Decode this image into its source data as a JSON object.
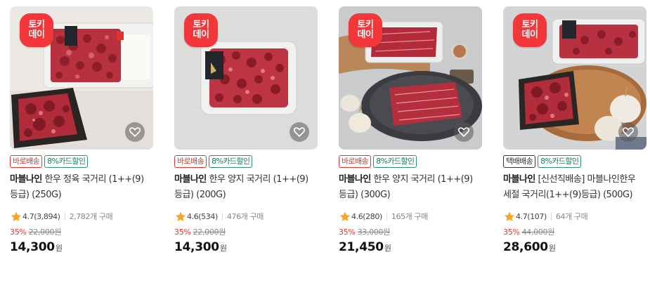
{
  "products": [
    {
      "promo_line1": "토키",
      "promo_line2": "데이",
      "badges": [
        {
          "label": "바로배송",
          "style": "red"
        },
        {
          "label": "8%카드할인",
          "style": "green"
        }
      ],
      "brand": "마블나인",
      "name": "한우 정육 국거리 (1++(9)등급) (250G)",
      "rating": "4.7(3,894)",
      "sold": "2,782개 구매",
      "discount": "35%",
      "original_price": "22,000원",
      "price": "14,300",
      "currency": "원",
      "wishlist_icon": "heart-icon"
    },
    {
      "promo_line1": "토키",
      "promo_line2": "데이",
      "badges": [
        {
          "label": "바로배송",
          "style": "red"
        },
        {
          "label": "8%카드할인",
          "style": "green"
        }
      ],
      "brand": "마블나인",
      "name": "한우 양지 국거리 (1++(9)등급) (200G)",
      "rating": "4.6(534)",
      "sold": "476개 구매",
      "discount": "35%",
      "original_price": "22,000원",
      "price": "14,300",
      "currency": "원",
      "wishlist_icon": "heart-icon"
    },
    {
      "promo_line1": "토키",
      "promo_line2": "데이",
      "badges": [
        {
          "label": "바로배송",
          "style": "red"
        },
        {
          "label": "8%카드할인",
          "style": "green"
        }
      ],
      "brand": "마블나인",
      "name": "한우 양지 국거리 (1++(9)등급) (300G)",
      "rating": "4.6(280)",
      "sold": "165개 구매",
      "discount": "35%",
      "original_price": "33,000원",
      "price": "21,450",
      "currency": "원",
      "wishlist_icon": "heart-icon"
    },
    {
      "promo_line1": "토키",
      "promo_line2": "데이",
      "badges": [
        {
          "label": "택배배송",
          "style": "dark"
        },
        {
          "label": "8%카드할인",
          "style": "green"
        }
      ],
      "brand": "마블나인",
      "name": "[신선직배송] 마블나인한우 세절 국거리(1++(9)등급) (500G)",
      "rating": "4.7(107)",
      "sold": "64개 구매",
      "discount": "35%",
      "original_price": "44,000원",
      "price": "28,600",
      "currency": "원",
      "wishlist_icon": "heart-icon"
    }
  ],
  "colors": {
    "promo_badge": "#f2363a",
    "discount_red": "#e4332b",
    "card_discount_green": "#177a5d",
    "star": "#f5a623"
  }
}
